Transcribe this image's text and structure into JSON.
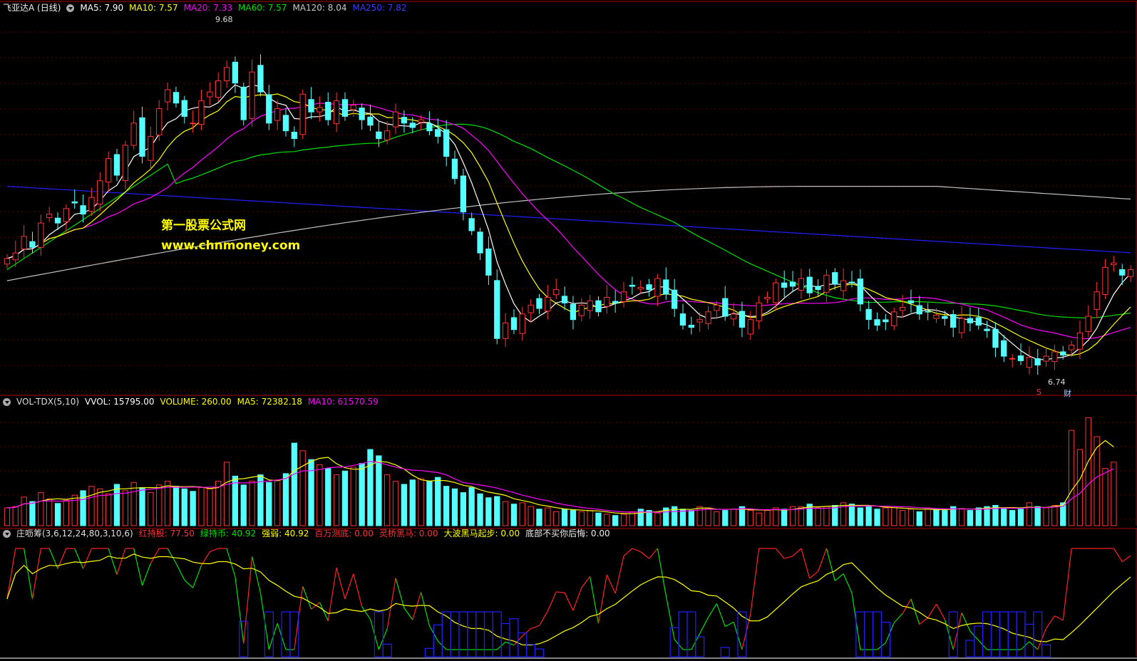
{
  "panel1": {
    "title": "飞亚达A (日线)",
    "ma5": "MA5: 7.90",
    "ma10": "MA10: 7.57",
    "ma20": "MA20: 7.33",
    "ma60": "MA60: 7.57",
    "ma120": "MA120: 8.04",
    "ma250": "MA250: 7.82",
    "high_label": "9.68",
    "low_label": "6.74",
    "marker_s": "S",
    "marker_cai": "财"
  },
  "panel2": {
    "title": "VOL-TDX(5,10)",
    "vvol": "VVOL: 15795.00",
    "volume": "VOLUME: 260.00",
    "ma5": "MA5: 72382.18",
    "ma10": "MA10: 61570.59"
  },
  "panel3": {
    "title": "庄呖筹(3,6,12,24,80,3,10,6)",
    "hongchi": "红持股: 77.50",
    "lvchi": "绿持币: 40.92",
    "qiangruo": "强弱: 40.92",
    "baiwan": "百万测底: 0.00",
    "lingqiao": "灵桥黑马: 0.00",
    "dabo": "大波黑马起步: 0.00",
    "dibu": "底部不买你后悔: 0.00"
  },
  "watermark": {
    "line1": "第一股票公式网",
    "line2": "www.chnmoney.com"
  },
  "colors": {
    "up": "#ff3232",
    "down": "#54ffff",
    "ma5": "#ffffff",
    "ma10": "#ffff00",
    "ma20": "#ff00ff",
    "ma60": "#00e000",
    "ma120": "#c0c0c0",
    "ma250": "#2020ff"
  },
  "chart_data": {
    "type": "candlestick",
    "price_range": [
      6.5,
      9.9
    ],
    "closes": [
      7.7,
      7.75,
      7.9,
      7.8,
      8.02,
      8.1,
      8.02,
      8.15,
      8.2,
      8.1,
      8.25,
      8.4,
      8.6,
      8.45,
      8.72,
      8.92,
      8.62,
      8.8,
      9.05,
      9.22,
      9.1,
      8.98,
      8.92,
      9.12,
      9.2,
      9.3,
      9.42,
      9.28,
      8.95,
      9.38,
      9.2,
      8.92,
      9.05,
      8.85,
      8.78,
      9.18,
      9.02,
      9.06,
      8.95,
      9.12,
      8.98,
      9.08,
      8.95,
      8.9,
      8.78,
      8.85,
      9.02,
      8.92,
      8.88,
      8.95,
      8.85,
      8.8,
      8.62,
      8.42,
      8.12,
      7.95,
      7.75,
      7.55,
      6.98,
      7.12,
      7.06,
      7.2,
      7.28,
      7.25,
      7.35,
      7.42,
      7.3,
      7.15,
      7.28,
      7.32,
      7.22,
      7.35,
      7.3,
      7.4,
      7.45,
      7.44,
      7.42,
      7.52,
      7.38,
      7.25,
      7.1,
      7.08,
      7.15,
      7.22,
      7.28,
      7.18,
      7.2,
      7.08,
      7.15,
      7.3,
      7.35,
      7.48,
      7.44,
      7.45,
      7.52,
      7.39,
      7.42,
      7.55,
      7.47,
      7.5,
      7.48,
      7.29,
      7.15,
      7.1,
      7.13,
      7.22,
      7.26,
      7.3,
      7.2,
      7.22,
      7.19,
      7.16,
      7.08,
      7.16,
      7.12,
      7.1,
      7.05,
      6.9,
      6.82,
      6.8,
      6.78,
      6.81,
      6.74,
      6.82,
      6.86,
      6.83,
      6.92,
      7.03,
      7.18,
      7.4,
      7.62,
      7.66,
      7.55,
      7.6
    ],
    "volume_range": [
      0,
      185000
    ],
    "volumes": [
      28000,
      30000,
      45000,
      38000,
      52000,
      42000,
      35000,
      40000,
      48000,
      55000,
      62000,
      58000,
      50000,
      65000,
      55000,
      68000,
      60000,
      52000,
      64000,
      70000,
      62000,
      58000,
      54000,
      60000,
      58000,
      70000,
      100000,
      78000,
      64000,
      70000,
      80000,
      68000,
      72000,
      82000,
      130000,
      118000,
      104000,
      96000,
      90000,
      80000,
      86000,
      92000,
      98000,
      120000,
      110000,
      80000,
      70000,
      65000,
      72000,
      74000,
      70000,
      76000,
      62000,
      58000,
      52000,
      60000,
      50000,
      44000,
      46000,
      38000,
      34000,
      36000,
      30000,
      26000,
      28000,
      22000,
      26000,
      24000,
      22000,
      24000,
      20000,
      18000,
      16000,
      18000,
      22000,
      26000,
      24000,
      20000,
      28000,
      30000,
      26000,
      24000,
      30000,
      28000,
      22000,
      24000,
      26000,
      30000,
      24000,
      20000,
      24000,
      28000,
      26000,
      30000,
      30000,
      34000,
      28000,
      30000,
      32000,
      36000,
      34000,
      28000,
      30000,
      26000,
      28000,
      30000,
      24000,
      26000,
      22000,
      28000,
      26000,
      24000,
      30000,
      26000,
      24000,
      28000,
      30000,
      32000,
      28000,
      24000,
      26000,
      36000,
      30000,
      28000,
      32000,
      36000,
      150000,
      120000,
      170000,
      140000,
      90000,
      100000
    ]
  }
}
